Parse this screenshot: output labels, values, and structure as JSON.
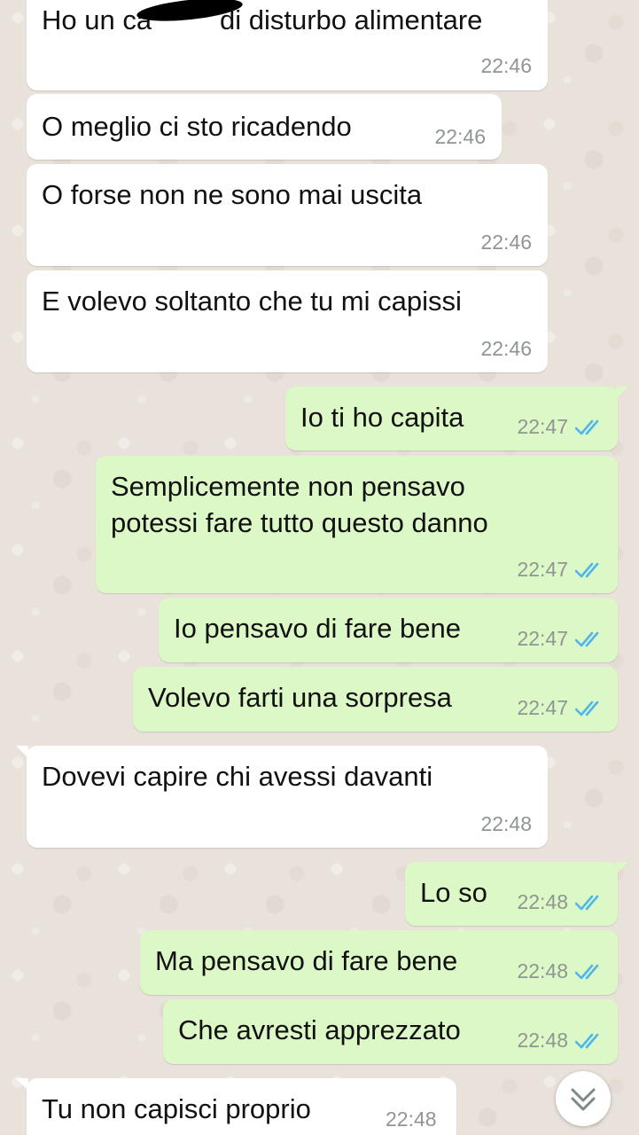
{
  "messages": [
    {
      "direction": "in",
      "text": "Ho un ca___ di disturbo alimentare",
      "time": "22:46",
      "text_parts": [
        "Ho un ca",
        "di disturbo alimentare"
      ]
    },
    {
      "direction": "in",
      "text": "O meglio ci sto ricadendo",
      "time": "22:46"
    },
    {
      "direction": "in",
      "text": "O forse non ne sono mai uscita",
      "time": "22:46"
    },
    {
      "direction": "in",
      "text": "E volevo soltanto che tu mi capissi",
      "time": "22:46"
    },
    {
      "direction": "out",
      "text": "Io ti ho capita",
      "time": "22:47",
      "status": "read"
    },
    {
      "direction": "out",
      "lines": [
        "Semplicemente non pensavo",
        "potessi fare tutto questo danno"
      ],
      "time": "22:47",
      "status": "read"
    },
    {
      "direction": "out",
      "text": "Io pensavo di fare bene",
      "time": "22:47",
      "status": "read"
    },
    {
      "direction": "out",
      "text": "Volevo farti una sorpresa",
      "time": "22:47",
      "status": "read"
    },
    {
      "direction": "in",
      "text": "Dovevi capire chi avessi davanti",
      "time": "22:48"
    },
    {
      "direction": "out",
      "text": "Lo so",
      "time": "22:48",
      "status": "read"
    },
    {
      "direction": "out",
      "text": "Ma pensavo di fare bene",
      "time": "22:48",
      "status": "read"
    },
    {
      "direction": "out",
      "text": "Che avresti apprezzato",
      "time": "22:48",
      "status": "read"
    },
    {
      "direction": "in",
      "text": "Tu non capisci proprio",
      "time": "22:48"
    }
  ],
  "colors": {
    "chat_background": "#e9e2da",
    "incoming_bubble": "#ffffff",
    "outgoing_bubble": "#dcf8c6",
    "timestamp": "#8f9691",
    "read_ticks": "#4fb6ec"
  },
  "icons": {
    "read_receipt": "double-check-icon",
    "scroll_down": "chevron-double-down-icon",
    "redaction": "redaction-mark"
  }
}
